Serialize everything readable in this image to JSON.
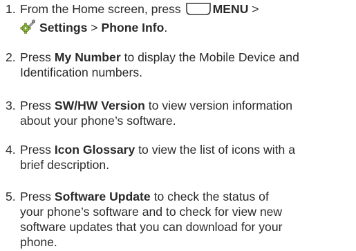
{
  "steps": [
    {
      "number": "1.",
      "line1_prefix": "From the Home screen, press ",
      "menu_icon": "menu-key-icon",
      "menu_label": "MENU",
      "line1_suffix": " >",
      "settings_icon": "settings-gear-icon",
      "settings_label": "Settings",
      "separator": " > ",
      "phone_info_label": "Phone Info",
      "end": "."
    },
    {
      "number": "2.",
      "prefix": "Press ",
      "bold": "My Number",
      "line1_rest": " to display the Mobile Device and",
      "line2": "Identification numbers."
    },
    {
      "number": "3.",
      "prefix": "Press ",
      "bold": "SW/HW Version",
      "line1_rest": " to view version information",
      "line2": "about your phone’s software."
    },
    {
      "number": "4.",
      "prefix": "Press ",
      "bold": "Icon Glossary",
      "line1_rest": " to view the list of icons with a",
      "line2": "brief description."
    },
    {
      "number": "5.",
      "prefix": "Press ",
      "bold": "Software Update",
      "line1_rest": " to check the status of",
      "line2": "your phone’s software and to check for view new",
      "line3": "software updates that you can download for your",
      "line4": "phone."
    }
  ]
}
